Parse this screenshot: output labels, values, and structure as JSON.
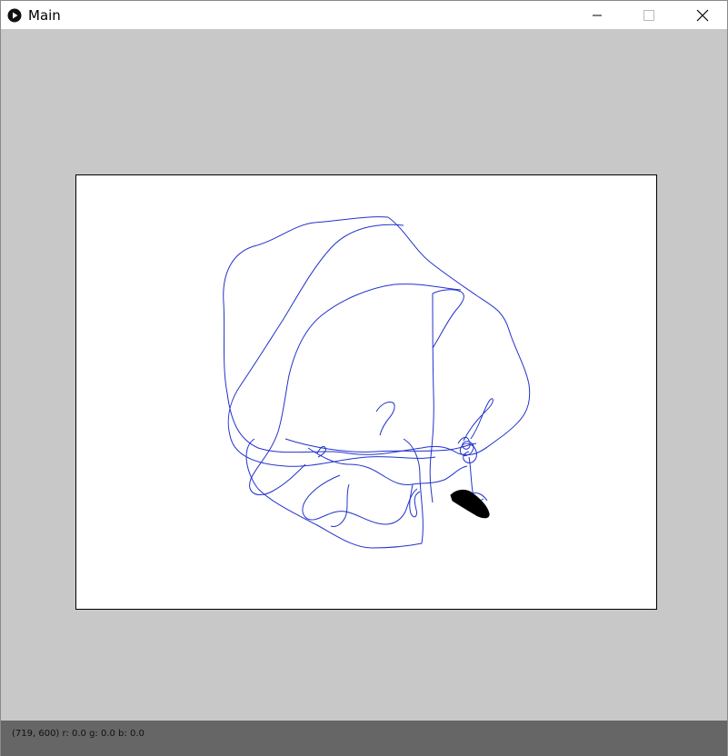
{
  "window": {
    "title": "Main",
    "controls": {
      "minimize_icon": "minimize-icon",
      "maximize_icon": "maximize-icon",
      "close_icon": "close-icon"
    }
  },
  "canvas": {
    "background_color": "#c8c8c8",
    "panel_color": "#ffffff",
    "trace_color": "#2233cc",
    "blob_color": "#000000"
  },
  "status": {
    "text": "(719, 600) r: 0.0 g: 0.0 b: 0.0"
  }
}
